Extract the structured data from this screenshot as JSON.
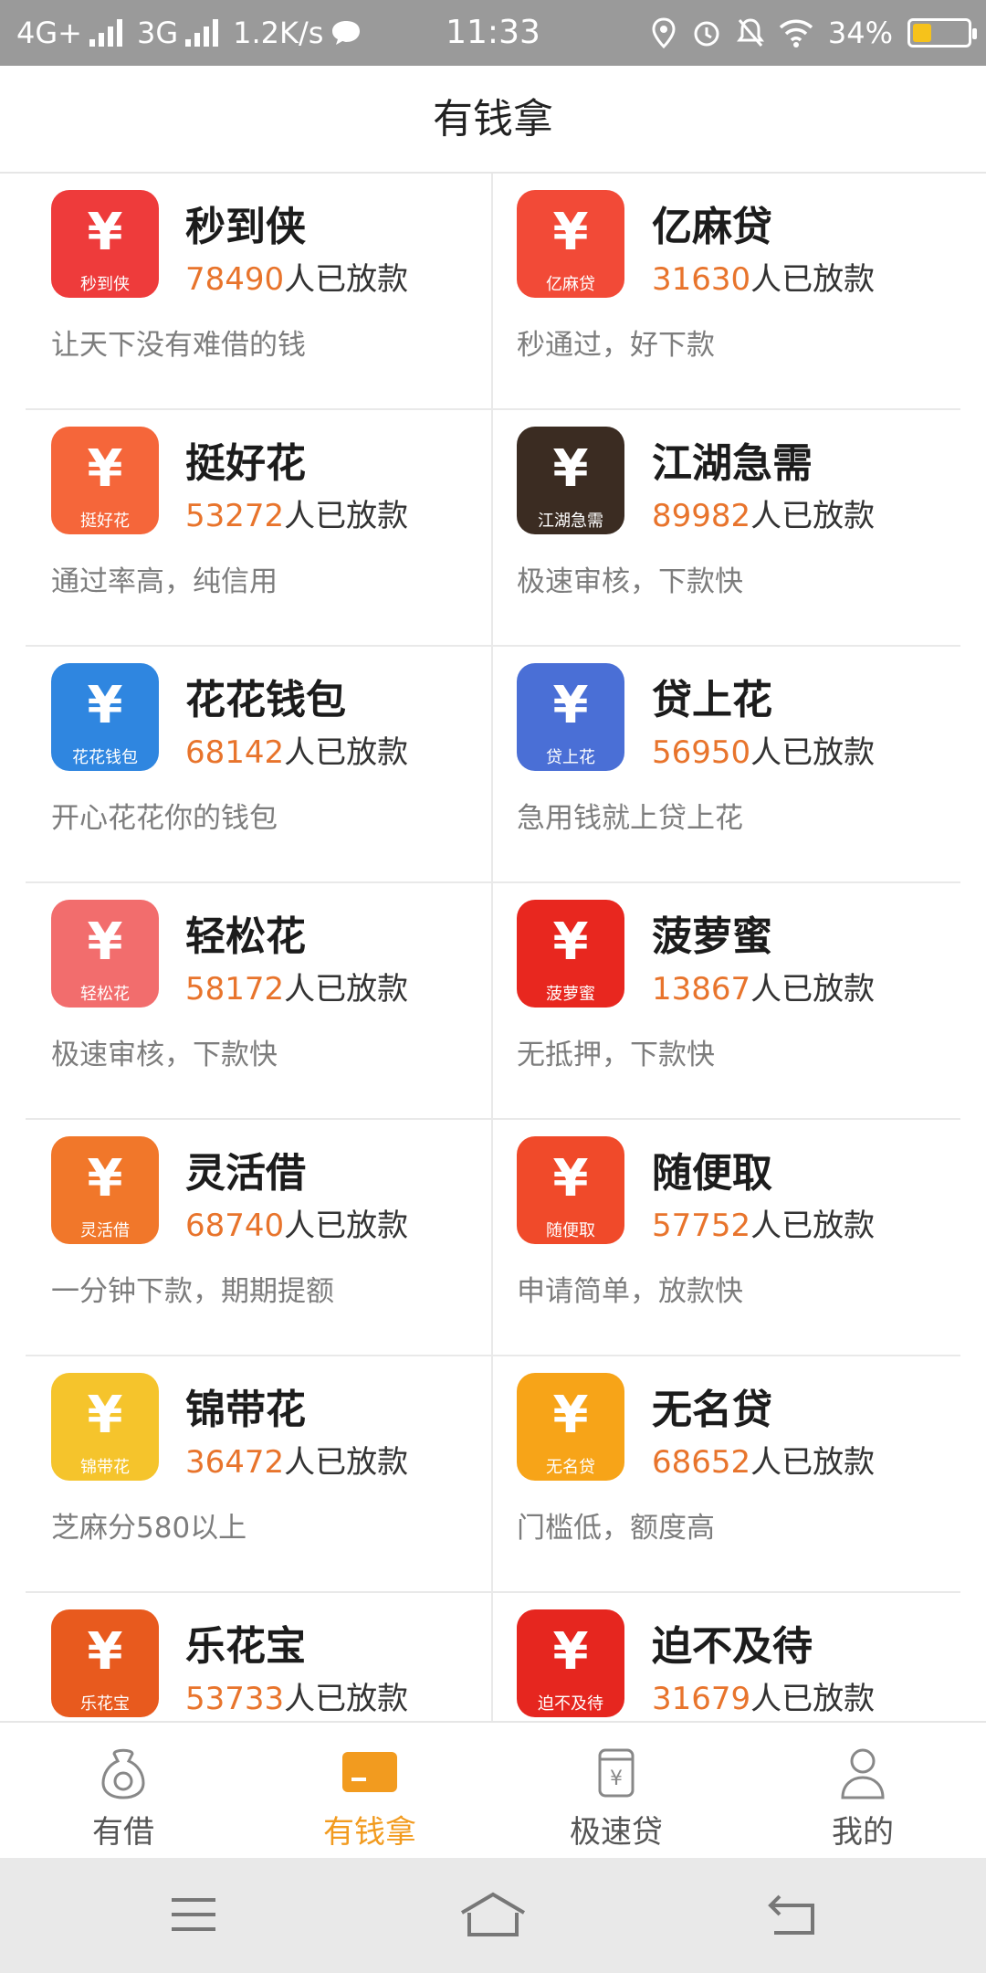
{
  "status_bar": {
    "network1": "4G+",
    "network2": "3G",
    "speed": "1.2K/s",
    "time": "11:33",
    "battery": "34%",
    "battery_level": 0.34
  },
  "header": {
    "title": "有钱拿"
  },
  "count_suffix": "人已放款",
  "apps": [
    {
      "name": "秒到侠",
      "count": "78490",
      "desc": "让天下没有难借的钱",
      "icon_text": "秒到侠",
      "color": "#ee3b3b"
    },
    {
      "name": "亿麻贷",
      "count": "31630",
      "desc": "秒通过，好下款",
      "icon_text": "亿麻贷",
      "color": "#f24a37"
    },
    {
      "name": "挺好花",
      "count": "53272",
      "desc": "通过率高，纯信用",
      "icon_text": "挺好花",
      "color": "#f5663a"
    },
    {
      "name": "江湖急需",
      "count": "89982",
      "desc": "极速审核，下款快",
      "icon_text": "江湖急需",
      "color": "#3b2c22"
    },
    {
      "name": "花花钱包",
      "count": "68142",
      "desc": "开心花花你的钱包",
      "icon_text": "花花钱包",
      "color": "#2f86e0"
    },
    {
      "name": "贷上花",
      "count": "56950",
      "desc": "急用钱就上贷上花",
      "icon_text": "贷上花",
      "color": "#4a6fd6"
    },
    {
      "name": "轻松花",
      "count": "58172",
      "desc": "极速审核，下款快",
      "icon_text": "轻松花",
      "color": "#f26d6d"
    },
    {
      "name": "菠萝蜜",
      "count": "13867",
      "desc": "无抵押，下款快",
      "icon_text": "菠萝蜜",
      "color": "#e8271f"
    },
    {
      "name": "灵活借",
      "count": "68740",
      "desc": "一分钟下款，期期提额",
      "icon_text": "灵活借",
      "color": "#f1772a"
    },
    {
      "name": "随便取",
      "count": "57752",
      "desc": "申请简单，放款快",
      "icon_text": "随便取",
      "color": "#f04a2a"
    },
    {
      "name": "锦带花",
      "count": "36472",
      "desc": "芝麻分580以上",
      "icon_text": "锦带花",
      "color": "#f5c42c"
    },
    {
      "name": "无名贷",
      "count": "68652",
      "desc": "门槛低，额度高",
      "icon_text": "无名贷",
      "color": "#f7a418"
    },
    {
      "name": "乐花宝",
      "count": "53733",
      "desc": "",
      "icon_text": "乐花宝",
      "color": "#e85a1e"
    },
    {
      "name": "迫不及待",
      "count": "31679",
      "desc": "",
      "icon_text": "迫不及待",
      "color": "#e6261f"
    }
  ],
  "tabs": [
    {
      "label": "有借",
      "icon": "loan-bag-icon",
      "active": false
    },
    {
      "label": "有钱拿",
      "icon": "card-icon",
      "active": true
    },
    {
      "label": "极速贷",
      "icon": "yen-jar-icon",
      "active": false
    },
    {
      "label": "我的",
      "icon": "person-icon",
      "active": false
    }
  ],
  "colors": {
    "accent": "#f29b1f",
    "count": "#e8742c",
    "statusbar": "#9a9a9a"
  }
}
